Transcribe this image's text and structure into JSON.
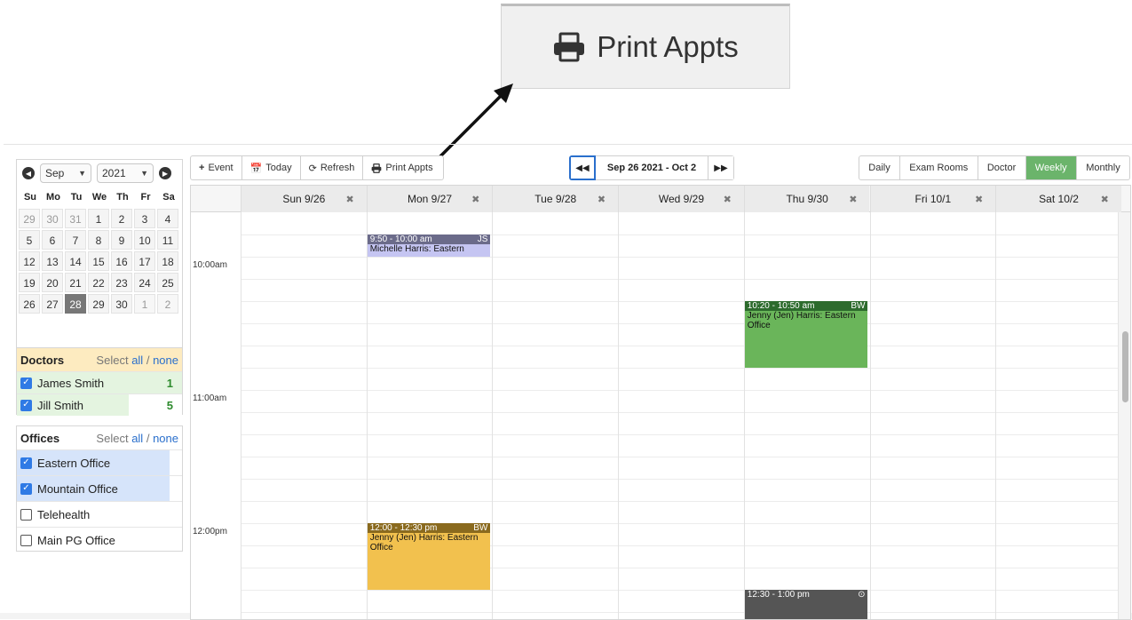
{
  "callout": {
    "label": "Print Appts",
    "icon": "printer-icon"
  },
  "mini_calendar": {
    "month": "Sep",
    "year": "2021",
    "weekdays": [
      "Su",
      "Mo",
      "Tu",
      "We",
      "Th",
      "Fr",
      "Sa"
    ],
    "weeks": [
      [
        "29",
        "30",
        "31",
        "1",
        "2",
        "3",
        "4"
      ],
      [
        "5",
        "6",
        "7",
        "8",
        "9",
        "10",
        "11"
      ],
      [
        "12",
        "13",
        "14",
        "15",
        "16",
        "17",
        "18"
      ],
      [
        "19",
        "20",
        "21",
        "22",
        "23",
        "24",
        "25"
      ],
      [
        "26",
        "27",
        "28",
        "29",
        "30",
        "1",
        "2"
      ]
    ],
    "selected_day": "28"
  },
  "doctors": {
    "title": "Doctors",
    "select_prefix": "Select",
    "all": "all",
    "separator": "/",
    "none": "none",
    "items": [
      {
        "name": "James Smith",
        "count": "1",
        "checked": true
      },
      {
        "name": "Jill Smith",
        "count": "5",
        "checked": true
      }
    ]
  },
  "offices": {
    "title": "Offices",
    "select_prefix": "Select",
    "all": "all",
    "separator": "/",
    "none": "none",
    "items": [
      {
        "name": "Eastern Office",
        "checked": true
      },
      {
        "name": "Mountain Office",
        "checked": true
      },
      {
        "name": "Telehealth",
        "checked": false
      },
      {
        "name": "Main PG Office",
        "checked": false
      }
    ]
  },
  "toolbar": {
    "event": "Event",
    "today": "Today",
    "refresh": "Refresh",
    "print": "Print Appts",
    "range": "Sep 26 2021 - Oct 2",
    "views": [
      "Daily",
      "Exam Rooms",
      "Doctor",
      "Weekly",
      "Monthly"
    ],
    "active_view": "Weekly"
  },
  "days": [
    "Sun 9/26",
    "Mon 9/27",
    "Tue 9/28",
    "Wed 9/29",
    "Thu 9/30",
    "Fri 10/1",
    "Sat 10/2"
  ],
  "time_labels": [
    "10:00am",
    "11:00am",
    "12:00pm"
  ],
  "events": [
    {
      "day": "Mon 9/27",
      "time": "9:50 - 10:00 am",
      "initials": "JS",
      "title": "Michelle Harris: Eastern",
      "bar_color": "#6b6b8a",
      "body_color": "#c5c5f2"
    },
    {
      "day": "Thu 9/30",
      "time": "10:20 - 10:50 am",
      "initials": "BW",
      "title": "Jenny (Jen) Harris: Eastern Office",
      "bar_color": "#2d6b2d",
      "body_color": "#6ab55a"
    },
    {
      "day": "Mon 9/27",
      "time": "12:00 - 12:30 pm",
      "initials": "BW",
      "title": "Jenny (Jen) Harris: Eastern Office",
      "bar_color": "#8a6a1e",
      "body_color": "#f2c14e"
    },
    {
      "day": "Thu 9/30",
      "time": "12:30 - 1:00 pm",
      "initials": "",
      "title": "",
      "bar_color": "#555555",
      "body_color": "#555555"
    }
  ]
}
